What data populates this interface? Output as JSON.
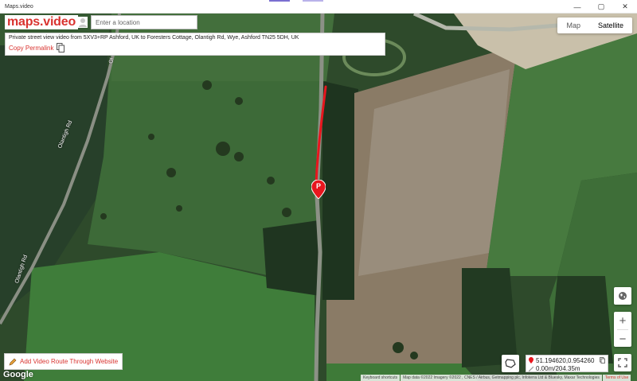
{
  "window": {
    "title": "Maps.video",
    "minimize": "—",
    "maximize": "▢",
    "close": "✕"
  },
  "header": {
    "logo": "maps.video",
    "search_placeholder": "Enter a location"
  },
  "info": {
    "description": "Private street view video from 5XV3+RP Ashford, UK to Foresters Cottage, Olantigh Rd, Wye, Ashford TN25 5DH, UK",
    "permalink_label": "Copy Permalink"
  },
  "map_type": {
    "map_label": "Map",
    "satellite_label": "Satellite",
    "active": "satellite"
  },
  "road_labels": {
    "olantigh_1": "Olantigh Rd",
    "olantigh_2": "Olantigh Rd",
    "olantigh_top": "Ol"
  },
  "controls": {
    "zoom_in": "+",
    "zoom_out": "−",
    "globe_icon": "globe-icon",
    "fullscreen_icon": "fullscreen-icon"
  },
  "add_route": {
    "label": "Add Video Route Through Website"
  },
  "coords": {
    "latlng": "51.194620,0.954260",
    "distance": "0.00m/204.35m"
  },
  "marker": {
    "label": "P"
  },
  "colors": {
    "brand": "#d9332f",
    "route": "#e8161e"
  },
  "attribution": {
    "google": "Google",
    "keyboard": "Keyboard shortcuts",
    "map_data": "Map data ©2022 Imagery ©2022 , CNES / Airbus, Getmapping plc, Infoterra Ltd & Bluesky, Maxar Technologies",
    "report": "Terms of Use"
  }
}
